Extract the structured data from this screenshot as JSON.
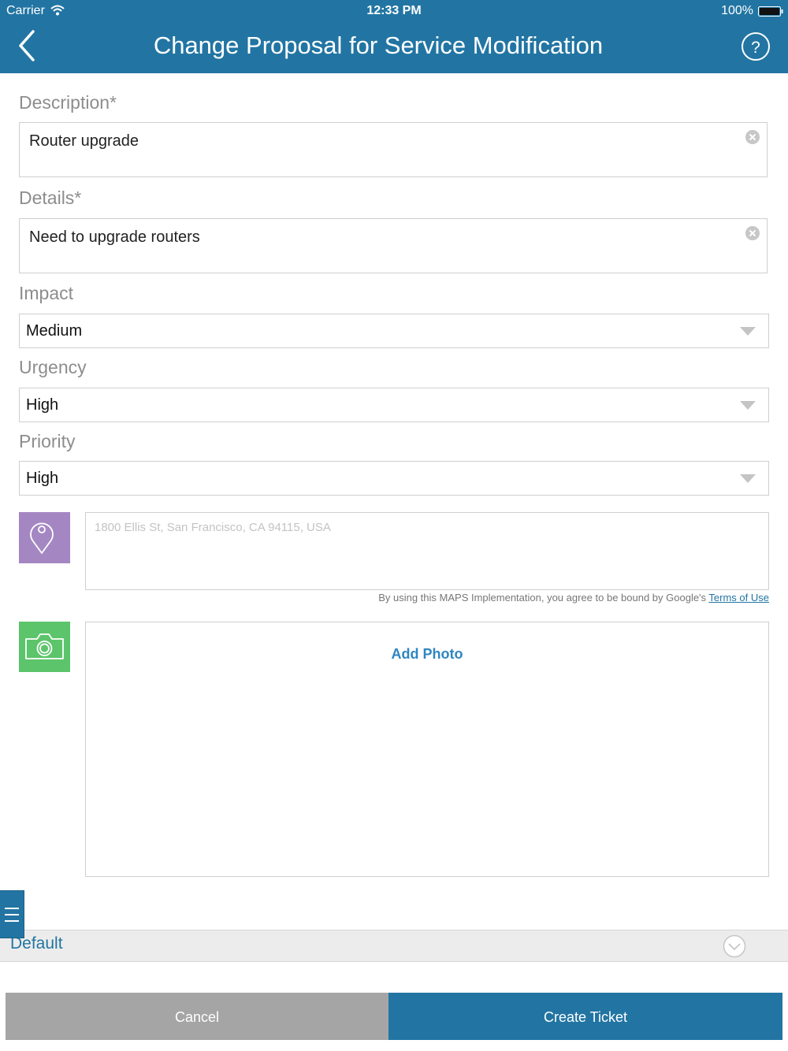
{
  "status_bar": {
    "carrier": "Carrier",
    "time": "12:33 PM",
    "battery": "100%"
  },
  "header": {
    "title": "Change Proposal for Service Modification",
    "back_icon": "chevron-left-icon",
    "help_icon": "question-circle-icon",
    "background_color": "#2275a3"
  },
  "form": {
    "description": {
      "label": "Description*",
      "value": "Router upgrade"
    },
    "details": {
      "label": "Details*",
      "value": "Need to upgrade routers"
    },
    "impact": {
      "label": "Impact",
      "value": "Medium"
    },
    "urgency": {
      "label": "Urgency",
      "value": "High"
    },
    "priority": {
      "label": "Priority",
      "value": "High"
    },
    "location": {
      "placeholder": "1800 Ellis St, San Francisco, CA 94115, USA",
      "icon": "map-pin-icon",
      "tile_color": "#a487c2"
    },
    "maps_notice": {
      "text": "By using this MAPS Implementation, you agree to be bound by Google's ",
      "link": "Terms of Use"
    },
    "photo": {
      "label": "Add Photo",
      "icon": "camera-icon",
      "tile_color": "#5cc46a"
    }
  },
  "bottom": {
    "default_label": "Default",
    "menu_icon": "hamburger-menu-icon",
    "expand_icon": "chevron-down-circle-icon",
    "cancel_label": "Cancel",
    "create_label": "Create Ticket"
  }
}
